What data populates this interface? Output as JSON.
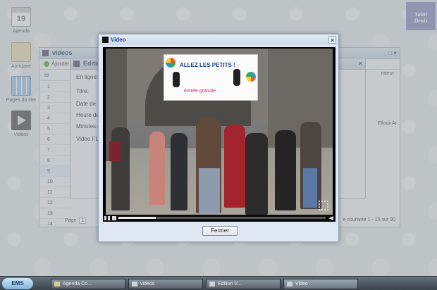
{
  "desktop": {
    "icons": [
      {
        "label": "Agenda",
        "day": "19"
      },
      {
        "label": "Annuaire"
      },
      {
        "label": "Pages du site"
      },
      {
        "label": "Videos"
      }
    ],
    "logo": {
      "line1": "Saint",
      "line2": "Denis"
    }
  },
  "videos_window": {
    "title": "videos",
    "toolbar": {
      "add_label": "Ajouter"
    },
    "columns": [
      "Id",
      "En"
    ],
    "row_ids": [
      "1",
      "2",
      "3",
      "4",
      "5",
      "6",
      "7",
      "8",
      "9",
      "10",
      "11",
      "12",
      "13",
      "14"
    ],
    "paging": {
      "page_label": "Page",
      "page_value": "1",
      "summary": "e courante 1 - 15 sur 90"
    },
    "right_col_header": "rateur",
    "right_col_value": "Ellouii Ar"
  },
  "edition_window": {
    "title": "Edition",
    "fields": [
      "En ligne:",
      "Titre:",
      "Date de",
      "Heure de",
      "Minutes d",
      "Video FL"
    ]
  },
  "video_dialog": {
    "title": "Video",
    "close_symbol": "×",
    "fermer_label": "Fermer",
    "progress": 0.18,
    "banner": {
      "line1": "ALLEZ LES PETITS !",
      "line2": "entrée gratuite"
    }
  },
  "taskbar": {
    "start_label": "EMS",
    "tasks": [
      {
        "label": "Agenda Co..."
      },
      {
        "label": "videos"
      },
      {
        "label": "Edition V..."
      },
      {
        "label": "Video"
      }
    ]
  }
}
